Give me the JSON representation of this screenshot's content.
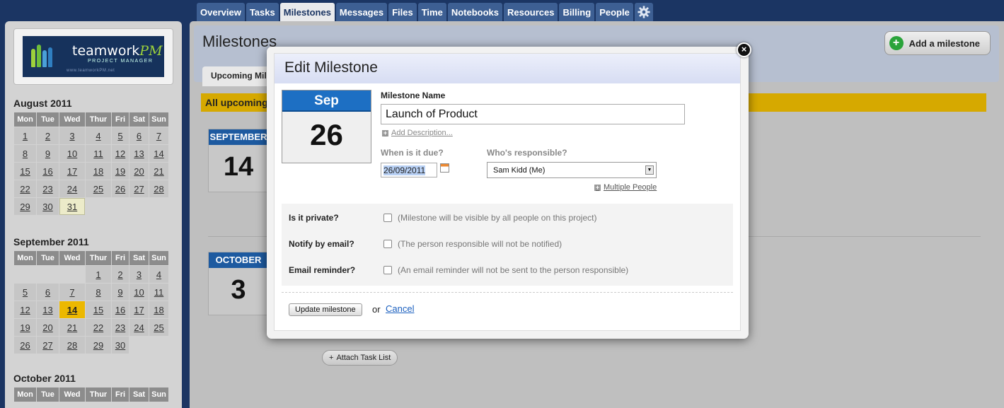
{
  "nav": {
    "tabs": [
      "Overview",
      "Tasks",
      "Milestones",
      "Messages",
      "Files",
      "Time",
      "Notebooks",
      "Resources",
      "Billing",
      "People"
    ],
    "active": "Milestones",
    "settings_icon": "gear-icon"
  },
  "logo": {
    "brand": "teamwork",
    "brand_suffix": "PM",
    "subtitle": "PROJECT MANAGER",
    "url": "www.teamworkPM.net"
  },
  "calendars": {
    "days": [
      "Mon",
      "Tue",
      "Wed",
      "Thur",
      "Fri",
      "Sat",
      "Sun"
    ],
    "august": {
      "title": "August 2011",
      "weeks": [
        [
          "1",
          "2",
          "3",
          "4",
          "5",
          "6",
          "7"
        ],
        [
          "8",
          "9",
          "10",
          "11",
          "12",
          "13",
          "14"
        ],
        [
          "15",
          "16",
          "17",
          "18",
          "19",
          "20",
          "21"
        ],
        [
          "22",
          "23",
          "24",
          "25",
          "26",
          "27",
          "28"
        ],
        [
          "29",
          "30",
          "31",
          "",
          "",
          "",
          ""
        ]
      ]
    },
    "september": {
      "title": "September 2011",
      "weeks": [
        [
          "",
          "",
          "",
          "1",
          "2",
          "3",
          "4"
        ],
        [
          "5",
          "6",
          "7",
          "8",
          "9",
          "10",
          "11"
        ],
        [
          "12",
          "13",
          "14",
          "15",
          "16",
          "17",
          "18"
        ],
        [
          "19",
          "20",
          "21",
          "22",
          "23",
          "24",
          "25"
        ],
        [
          "26",
          "27",
          "28",
          "29",
          "30",
          "",
          ""
        ]
      ]
    },
    "october": {
      "title": "October 2011"
    }
  },
  "main": {
    "title": "Milestones",
    "add_button": "Add a milestone",
    "subtab": "Upcoming Mile",
    "banner": "All upcoming",
    "blocks": [
      {
        "month": "SEPTEMBER",
        "day": "14"
      },
      {
        "month": "OCTOBER",
        "day": "3"
      }
    ],
    "attach_label": "Attach Task List"
  },
  "modal": {
    "title": "Edit Milestone",
    "close": "×",
    "date_month": "Sep",
    "date_day": "26",
    "name_label": "Milestone Name",
    "name_value": "Launch of Product",
    "add_description": "Add Description...",
    "due_label": "When is it due?",
    "due_value": "26/09/2011",
    "responsible_label": "Who's responsible?",
    "responsible_value": "Sam Kidd (Me)",
    "multiple_people": "Multiple People",
    "options": [
      {
        "label": "Is it private?",
        "desc": "(Milestone will be visible by all people on this project)"
      },
      {
        "label": "Notify by email?",
        "desc": "(The person responsible will not be notified)"
      },
      {
        "label": "Email reminder?",
        "desc": "(An email reminder will not be sent to the person responsible)"
      }
    ],
    "update_button": "Update milestone",
    "or": "or",
    "cancel": "Cancel"
  }
}
